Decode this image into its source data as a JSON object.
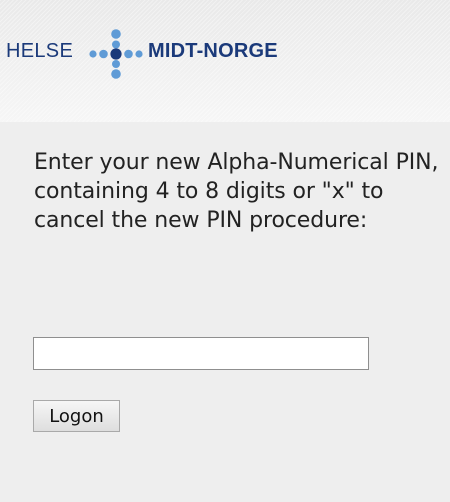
{
  "header": {
    "logo_left_text": "HELSE",
    "logo_right_text": "MIDT-NORGE",
    "logo_icon": "dots-cross-logo-icon",
    "colors": {
      "logo_text": "#1b3a7a",
      "logo_dot_large": "#1b3a7a",
      "logo_dot_small": "#5f9bd6"
    }
  },
  "form": {
    "prompt": "Enter your new Alpha-Numerical PIN, containing 4 to 8 digits or \"x\" to cancel the new PIN procedure:",
    "pin_value": "",
    "logon_label": "Logon"
  }
}
